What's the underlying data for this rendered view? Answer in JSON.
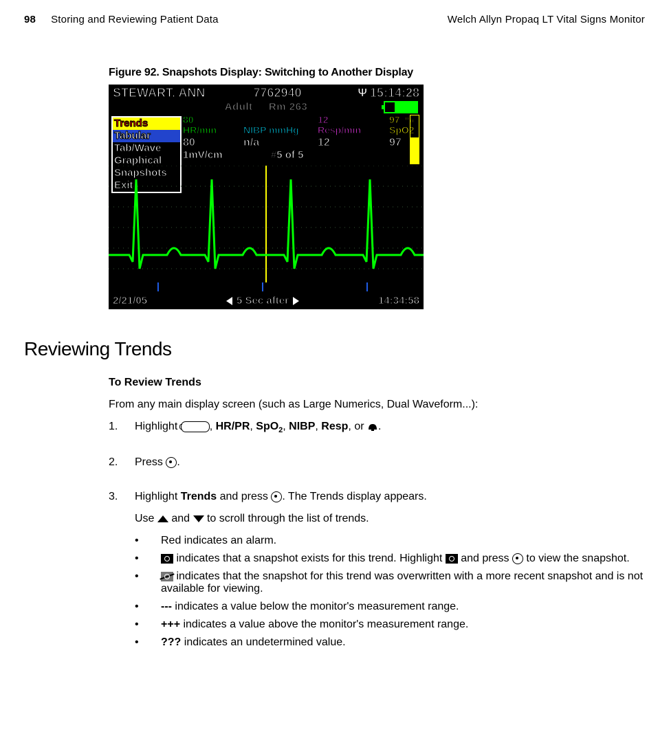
{
  "header": {
    "page_number": "98",
    "section_title": "Storing and Reviewing Patient Data",
    "product": "Welch Allyn Propaq LT Vital Signs Monitor"
  },
  "figure": {
    "caption": "Figure 92.  Snapshots Display: Switching to Another Display",
    "patient_name": "STEWART, ANN",
    "patient_id": "7762940",
    "time": "15:14:28",
    "mode": "Adult",
    "room": "Rm 263",
    "menu": {
      "items": [
        "Trends",
        "Tabular",
        "Tab/Wave",
        "Graphical",
        "Snapshots",
        "Exit"
      ],
      "highlighted_index": 0,
      "selected_index": 1
    },
    "vitals": {
      "hr": {
        "limit": "80",
        "label": "HR/min",
        "value": "80"
      },
      "nibp": {
        "label": "NIBP mmHg",
        "value": "n/a"
      },
      "resp": {
        "limit": "12",
        "label": "Resp/min",
        "value": "12"
      },
      "spo2": {
        "limit": "97",
        "unit": "%",
        "label": "SpO2",
        "value": "97"
      }
    },
    "scale": "1mV/cm",
    "snapshot_index": "#5 of 5",
    "footer_date": "2/21/05",
    "footer_offset": "5 Sec after",
    "footer_time": "14:34:58"
  },
  "section_heading": "Reviewing Trends",
  "subheading": "To Review Trends",
  "lead": "From any main display screen (such as Large Numerics, Dual Waveform...):",
  "steps": {
    "s1_a": "Highlight ",
    "s1_b": ", ",
    "s1_hrpr": "HR/PR",
    "s1_c": ", ",
    "s1_spo2": "SpO",
    "s1_spo2_sub": "2",
    "s1_d": ", ",
    "s1_nibp": "NIBP",
    "s1_e": ", ",
    "s1_resp": "Resp",
    "s1_f": ", or ",
    "s1_g": ".",
    "s2_a": "Press ",
    "s2_b": ".",
    "s3_a": "Highlight ",
    "s3_trends": "Trends",
    "s3_b": " and press ",
    "s3_c": ". The Trends display appears.",
    "s3_use_a": "Use ",
    "s3_use_b": " and ",
    "s3_use_c": " to scroll through the list of trends."
  },
  "bullets": {
    "b1": "Red indicates an alarm.",
    "b2_a": " indicates that a snapshot exists for this trend. Highlight ",
    "b2_b": " and press ",
    "b2_c": " to view the snapshot.",
    "b3": " indicates that the snapshot for this trend was overwritten with a more recent snapshot and is not available for viewing.",
    "b4_sym": "---",
    "b4": " indicates a value below the monitor's measurement range.",
    "b5_sym": "+++",
    "b5": " indicates a value above the monitor's measurement range.",
    "b6_sym": "???",
    "b6": " indicates an undetermined value."
  },
  "list_numbers": {
    "n1": "1.",
    "n2": "2.",
    "n3": "3."
  },
  "bullet_char": "•"
}
